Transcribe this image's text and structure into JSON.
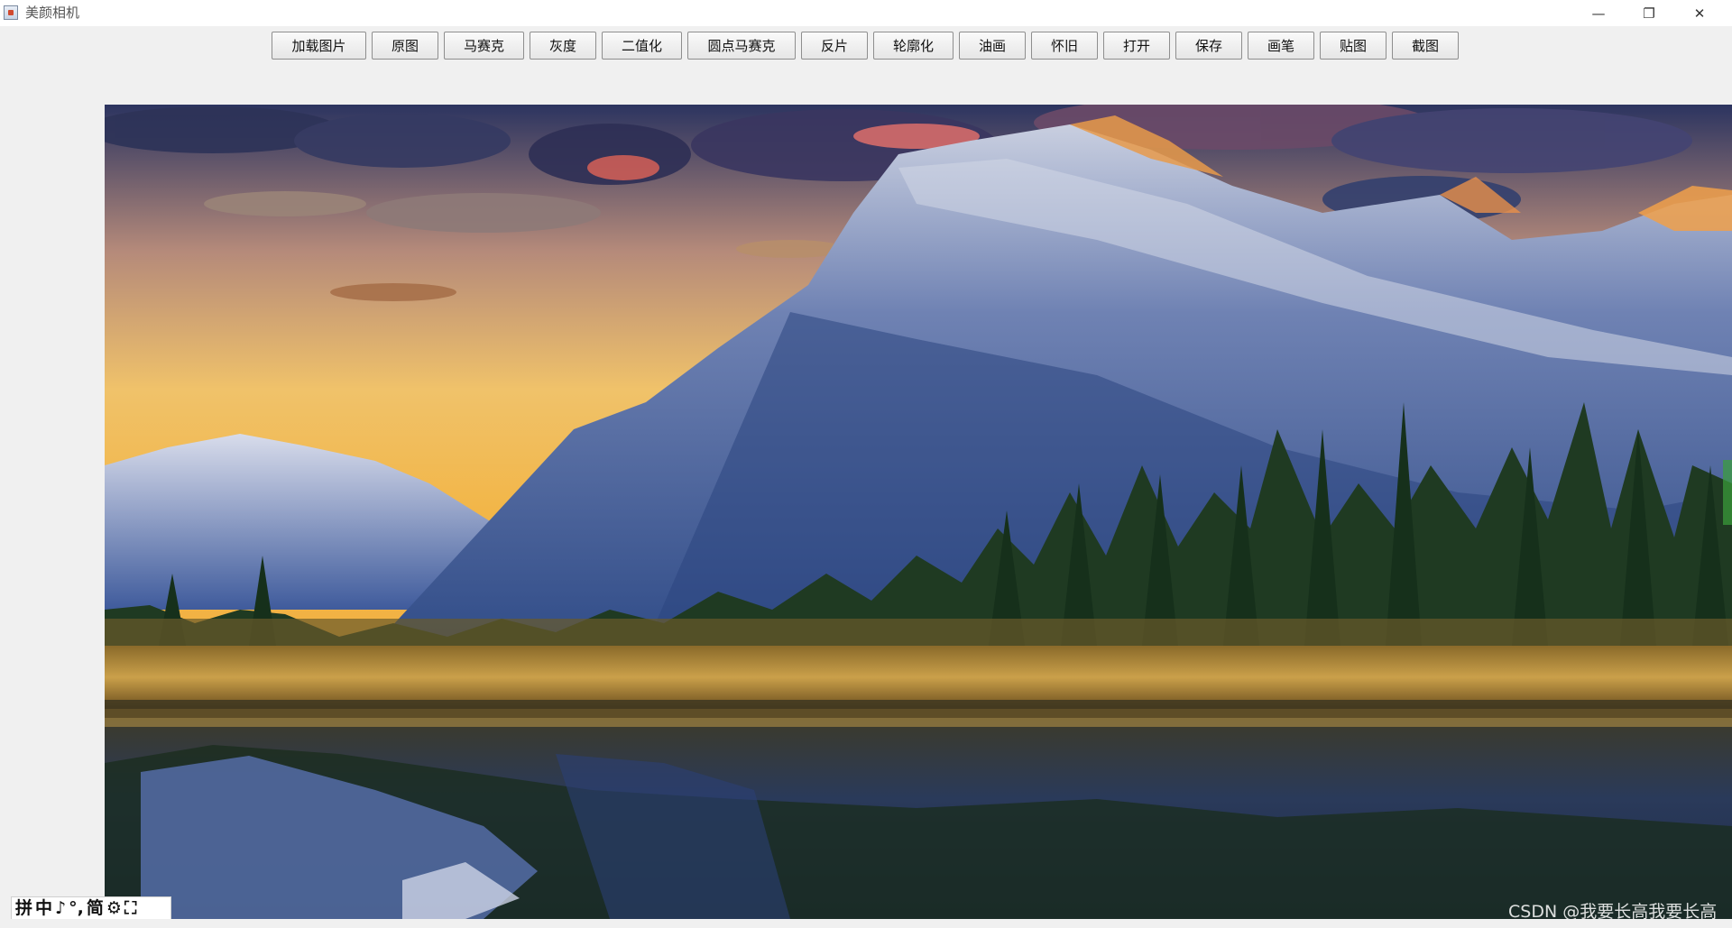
{
  "window": {
    "title": "美颜相机",
    "controls": {
      "minimize": "—",
      "maximize": "❐",
      "close": "✕"
    }
  },
  "toolbar": {
    "buttons": [
      {
        "label": "加载图片"
      },
      {
        "label": "原图"
      },
      {
        "label": "马赛克"
      },
      {
        "label": "灰度"
      },
      {
        "label": "二值化"
      },
      {
        "label": "圆点马赛克"
      },
      {
        "label": "反片"
      },
      {
        "label": "轮廓化"
      },
      {
        "label": "油画"
      },
      {
        "label": "怀旧"
      },
      {
        "label": "打开"
      },
      {
        "label": "保存"
      },
      {
        "label": "画笔"
      },
      {
        "label": "贴图"
      },
      {
        "label": "截图"
      }
    ]
  },
  "ime_bar": {
    "items": [
      "拼",
      "中",
      "♪",
      "°,",
      "简",
      "⚙",
      "⛶"
    ]
  },
  "watermark": "CSDN @我要长高我要长高",
  "colors": {
    "sky_top": "#2c3460",
    "sky_glow": "#f2b648",
    "mountain": "#4a5f94",
    "forest": "#1f3a22",
    "grass": "#b78a3b",
    "water": "#1e2a48"
  }
}
